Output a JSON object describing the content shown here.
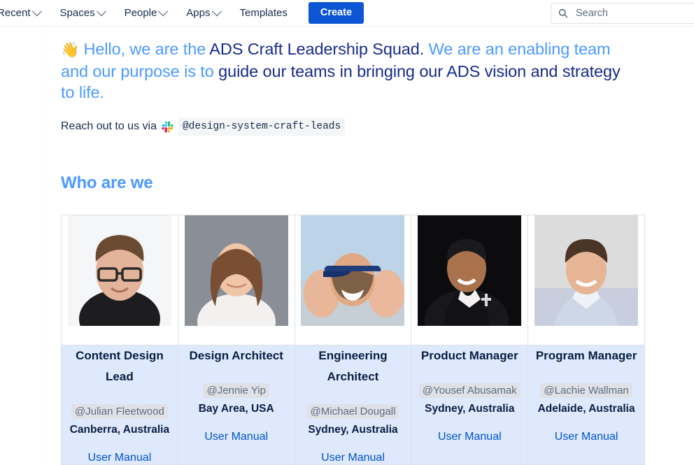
{
  "nav": {
    "items": [
      {
        "label": "Recent",
        "icon": "chevron-down-icon",
        "has_chevron": true
      },
      {
        "label": "Spaces",
        "icon": "chevron-down-icon",
        "has_chevron": true
      },
      {
        "label": "People",
        "icon": "chevron-down-icon",
        "has_chevron": true
      },
      {
        "label": "Apps",
        "icon": "chevron-down-icon",
        "has_chevron": true
      },
      {
        "label": "Templates",
        "has_chevron": false
      }
    ],
    "create_label": "Create",
    "create_color": "#0c56d4"
  },
  "search": {
    "placeholder": "Search",
    "icon": "search-icon"
  },
  "hero": {
    "wave_emoji": "👋",
    "seg1": " Hello, we are the ",
    "seg2": "ADS Craft Leadership Squad.",
    "seg3": " We are an enabling team and our purpose is to ",
    "seg4": "guide our teams in bringing our ADS vision and strategy",
    "seg5": " to life.",
    "light_color": "#4c9aff",
    "dark_color": "#172b8c"
  },
  "reach_out": {
    "text": "Reach out to us via",
    "icon": "slack-icon",
    "channel": "@design-system-craft-leads"
  },
  "section": {
    "heading": "Who are we"
  },
  "people": [
    {
      "role": "Content Design Lead",
      "mention": "@Julian Fleetwood",
      "location": "Canberra, Australia",
      "manual_label": "User Manual",
      "photo": "portrait-man-glasses-black-shirt"
    },
    {
      "role": "Design Architect",
      "mention": "@Jennie Yip",
      "location": "Bay Area, USA",
      "manual_label": "User Manual",
      "photo": "portrait-woman-long-hair-white-top"
    },
    {
      "role": "Engineering Architect",
      "mention": "@Michael Dougall",
      "location": "Sydney, Australia",
      "manual_label": "User Manual",
      "photo": "portrait-man-cap-beach-group"
    },
    {
      "role": "Product Manager",
      "mention": "@Yousef Abusamak",
      "location": "Sydney, Australia",
      "manual_label": "User Manual",
      "photo": "portrait-man-suit-dark-background"
    },
    {
      "role": "Program Manager",
      "mention": "@Lachie Wallman",
      "location": "Adelaide, Australia",
      "manual_label": "User Manual",
      "photo": "portrait-man-light-blue-shirt"
    }
  ],
  "colors": {
    "row_background": "#dee9fd",
    "link": "#0052cc",
    "mention_pill": "#dfe1e6",
    "table_border": "#dfe1e6"
  }
}
